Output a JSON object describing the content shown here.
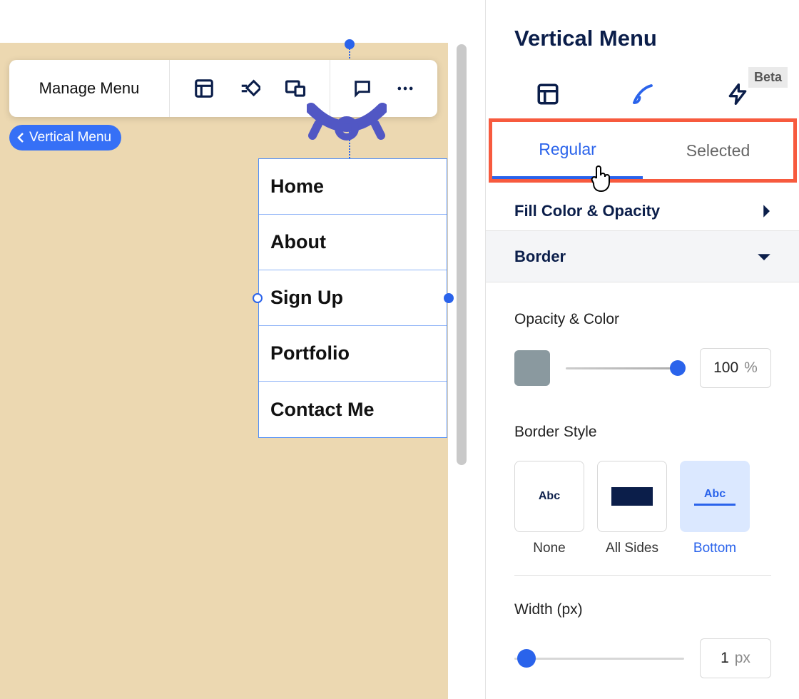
{
  "toolbar": {
    "manage_label": "Manage Menu"
  },
  "breadcrumb": {
    "label": "Vertical Menu"
  },
  "menu_items": [
    "Home",
    "About",
    "Sign Up",
    "Portfolio",
    "Contact Me"
  ],
  "panel": {
    "title": "Vertical Menu",
    "beta": "Beta",
    "tabs": {
      "regular": "Regular",
      "selected": "Selected"
    },
    "sections": {
      "fill": "Fill Color & Opacity",
      "border": "Border"
    },
    "opacity": {
      "label": "Opacity & Color",
      "value": "100",
      "unit": "%",
      "color": "#8a999f"
    },
    "border_style": {
      "label": "Border Style",
      "sample_text": "Abc",
      "options": {
        "none": "None",
        "all": "All Sides",
        "bottom": "Bottom"
      }
    },
    "width": {
      "label": "Width (px)",
      "value": "1",
      "unit": "px"
    }
  }
}
